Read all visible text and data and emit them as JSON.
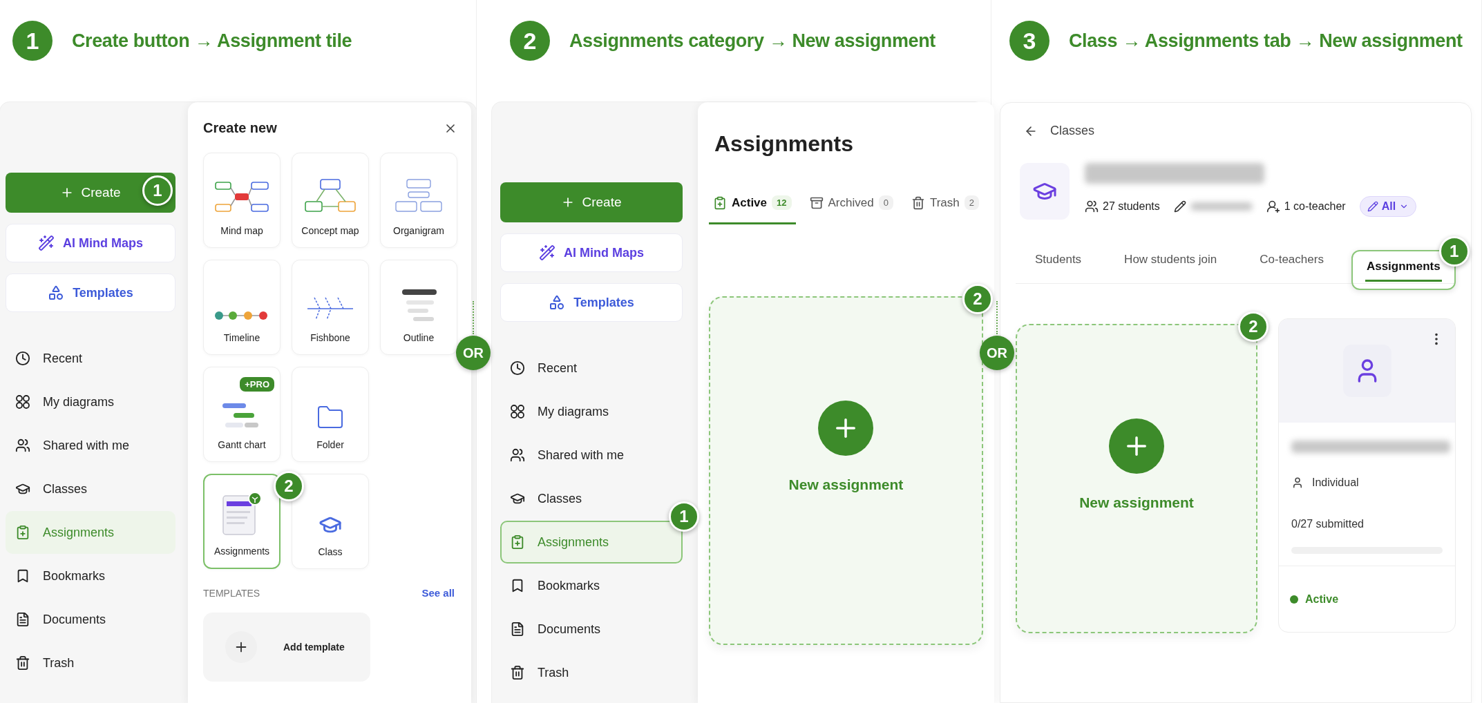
{
  "step_1": {
    "badge": "1",
    "title": "Create button → Assignment tile",
    "sidebar": {
      "create": {
        "label": "Create",
        "callout": "1"
      },
      "ai_button": "AI Mind Maps",
      "templates_button": "Templates",
      "items": [
        {
          "label": "Recent",
          "selected": false
        },
        {
          "label": "My diagrams",
          "selected": false
        },
        {
          "label": "Shared with me",
          "selected": false
        },
        {
          "label": "Classes",
          "selected": false
        },
        {
          "label": "Assignments",
          "selected": true
        },
        {
          "label": "Bookmarks",
          "selected": false
        },
        {
          "label": "Documents",
          "selected": false
        },
        {
          "label": "Trash",
          "selected": false
        }
      ]
    },
    "create_panel": {
      "title": "Create new",
      "tile_rows": [
        [
          {
            "label": "Mind map",
            "selected": false
          },
          {
            "label": "Concept map",
            "selected": false
          },
          {
            "label": "Organigram",
            "selected": false
          }
        ],
        [
          {
            "label": "Timeline",
            "selected": false
          },
          {
            "label": "Fishbone",
            "selected": false
          },
          {
            "label": "Outline",
            "selected": false
          }
        ],
        [
          {
            "label": "Gantt chart",
            "selected": false,
            "badge": "+PRO"
          },
          {
            "label": "Folder",
            "selected": false
          }
        ],
        [
          {
            "label": "Assignments",
            "selected": true,
            "callout": "2"
          },
          {
            "label": "Class",
            "selected": false
          }
        ]
      ],
      "templates_heading": "TEMPLATES",
      "see_all": "See all",
      "add_template": "Add template"
    }
  },
  "separators": [
    "OR",
    "OR"
  ],
  "step_2": {
    "badge": "2",
    "title": "Assignments category → New assignment",
    "sidebar": {
      "create": {
        "label": "Create"
      },
      "ai_button": "AI Mind Maps",
      "templates_button": "Templates",
      "items": [
        {
          "label": "Recent",
          "selected": false
        },
        {
          "label": "My diagrams",
          "selected": false
        },
        {
          "label": "Shared with me",
          "selected": false
        },
        {
          "label": "Classes",
          "selected": false
        },
        {
          "label": "Assignments",
          "selected": true,
          "callout": "1"
        },
        {
          "label": "Bookmarks",
          "selected": false
        },
        {
          "label": "Documents",
          "selected": false
        },
        {
          "label": "Trash",
          "selected": false
        }
      ]
    },
    "main": {
      "title": "Assignments",
      "tabs": [
        {
          "label": "Active",
          "count": "12",
          "selected": true
        },
        {
          "label": "Archived",
          "count": "0",
          "selected": false
        },
        {
          "label": "Trash",
          "count": "2",
          "selected": false
        }
      ],
      "new_card": {
        "label": "New assignment",
        "callout": "2"
      }
    }
  },
  "step_3": {
    "badge": "3",
    "title": "Class → Assignments tab → New assignment",
    "back": "Classes",
    "meta": {
      "students": "27 students",
      "co_teachers": "1 co-teacher",
      "filter": "All"
    },
    "tabs": [
      {
        "label": "Students",
        "selected": false
      },
      {
        "label": "How students join",
        "selected": false
      },
      {
        "label": "Co-teachers",
        "selected": false
      },
      {
        "label": "Assignments",
        "selected": true,
        "callout": "1"
      }
    ],
    "new_card": {
      "label": "New assignment",
      "callout": "2"
    },
    "assignment": {
      "type": "Individual",
      "submitted": "0/27 submitted",
      "level": 0,
      "status": {
        "label": "Active",
        "color": "#3d8b2a"
      }
    }
  }
}
